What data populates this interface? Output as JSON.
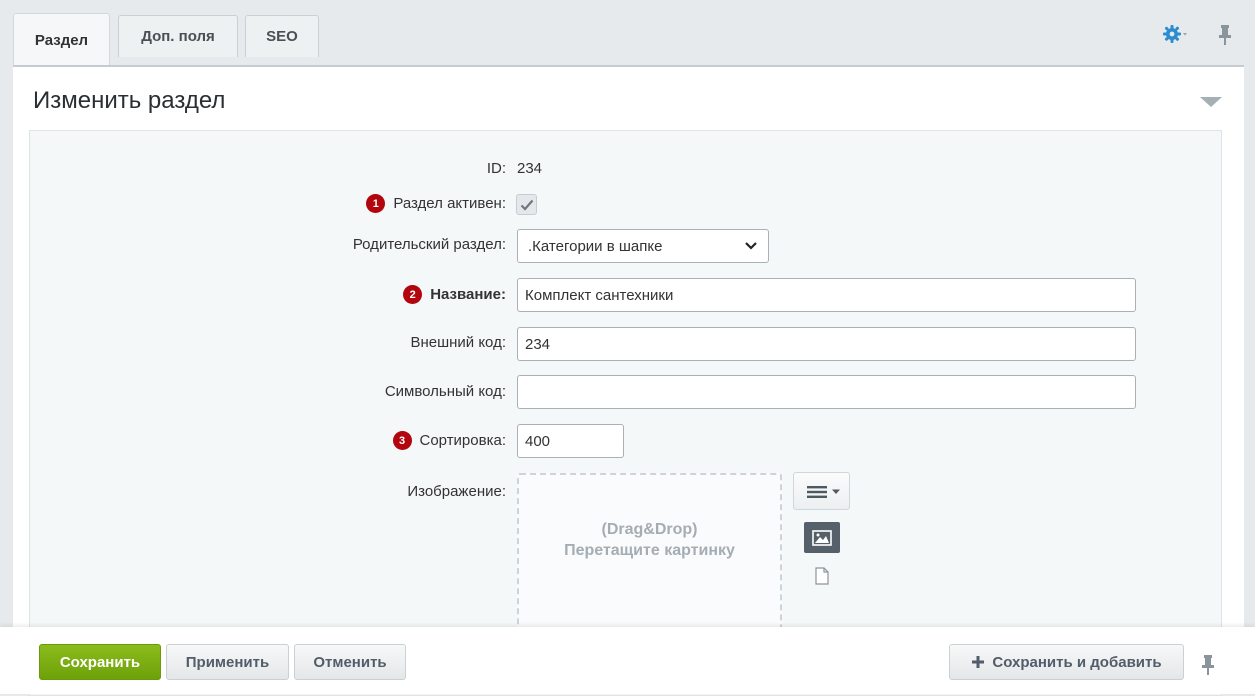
{
  "tabs": [
    {
      "label": "Раздел",
      "active": true
    },
    {
      "label": "Доп. поля",
      "active": false
    },
    {
      "label": "SEO",
      "active": false
    }
  ],
  "toolbar": {
    "settings_icon": "gear-icon",
    "pin_icon": "pin-icon"
  },
  "panel": {
    "title": "Изменить раздел"
  },
  "form": {
    "id_label": "ID:",
    "id_value": "234",
    "active_label": "Раздел активен:",
    "active_badge": "1",
    "active_checked": true,
    "parent_label": "Родительский раздел:",
    "parent_value": ".Категории в шапке",
    "name_label": "Название:",
    "name_badge": "2",
    "name_value": "Комплект сантехники",
    "xml_label": "Внешний код:",
    "xml_value": "234",
    "code_label": "Символьный код:",
    "code_value": "",
    "sort_label": "Сортировка:",
    "sort_badge": "3",
    "sort_value": "400",
    "image_label": "Изображение:",
    "dropzone_line1": "(Drag&Drop)",
    "dropzone_line2": "Перетащите картинку"
  },
  "footer": {
    "save": "Сохранить",
    "apply": "Применить",
    "cancel": "Отменить",
    "save_add": "Сохранить и добавить"
  },
  "colors": {
    "accent_green": "#7bb01b",
    "badge_red": "#b2050d",
    "gear_blue": "#2d8bd0"
  }
}
